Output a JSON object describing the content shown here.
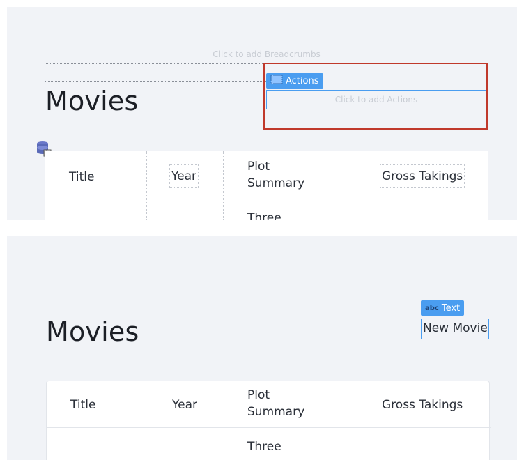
{
  "top": {
    "breadcrumbs_placeholder": "Click to add Breadcrumbs",
    "page_title": "Movies",
    "actions_tag": "Actions",
    "actions_placeholder": "Click to add Actions",
    "table": {
      "columns": [
        "Title",
        "Year",
        "Plot\nSummary",
        "Gross Takings"
      ],
      "first_row_plot": "Three"
    }
  },
  "bottom": {
    "text_tag_prefix": "abc",
    "text_tag": "Text",
    "new_movie_text": "New Movie",
    "page_title": "Movies",
    "table": {
      "columns": [
        "Title",
        "Year",
        "Plot\nSummary",
        "Gross Takings"
      ],
      "first_row_plot": "Three"
    }
  },
  "colors": {
    "accent": "#4a9df0",
    "selection_red": "#c0392b",
    "panel_bg": "#f1f3f7"
  },
  "icons": {
    "actions": "component-icon",
    "datasource": "database-icon"
  }
}
